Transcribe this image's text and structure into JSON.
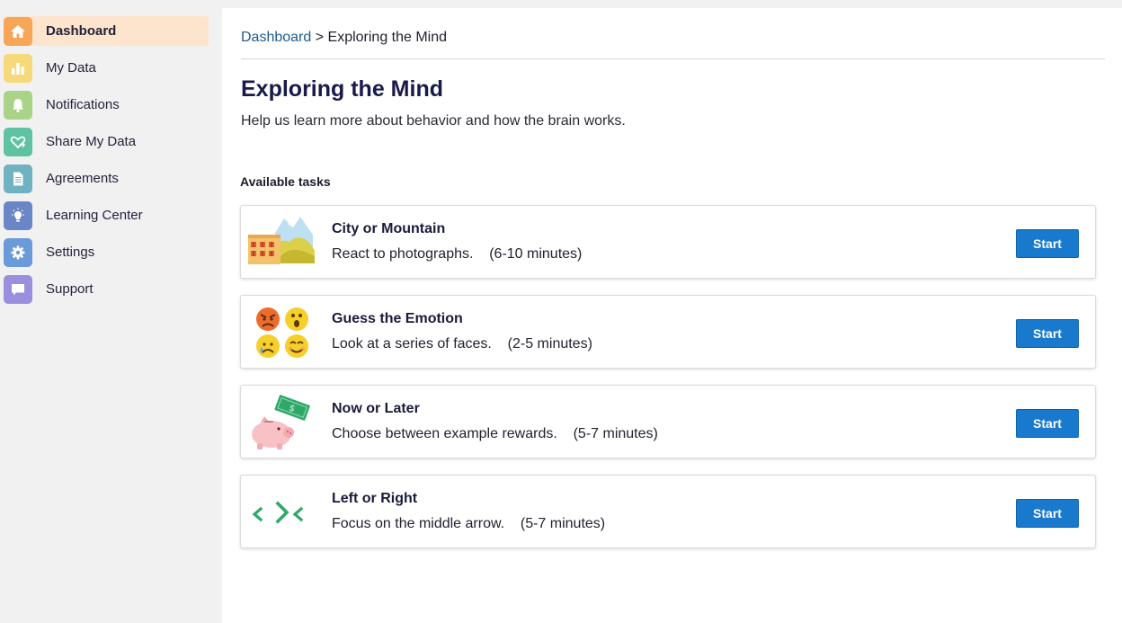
{
  "sidebar": {
    "items": [
      {
        "label": "Dashboard",
        "icon": "home-icon",
        "color": "#f7a556",
        "active": true
      },
      {
        "label": "My Data",
        "icon": "bar-chart-icon",
        "color": "#f5d97a"
      },
      {
        "label": "Notifications",
        "icon": "bell-icon",
        "color": "#a9d488"
      },
      {
        "label": "Share My Data",
        "icon": "heart-share-icon",
        "color": "#5fc2a0"
      },
      {
        "label": "Agreements",
        "icon": "document-icon",
        "color": "#6fb2c2"
      },
      {
        "label": "Learning Center",
        "icon": "lightbulb-icon",
        "color": "#6b86c6"
      },
      {
        "label": "Settings",
        "icon": "gear-icon",
        "color": "#6b9ad8"
      },
      {
        "label": "Support",
        "icon": "chat-bubble-icon",
        "color": "#9a8fdc"
      }
    ]
  },
  "breadcrumb": {
    "link": "Dashboard",
    "separator": " > ",
    "current": "Exploring the Mind"
  },
  "page": {
    "title": "Exploring the Mind",
    "subtitle": "Help us learn more about behavior and how the brain works.",
    "section_heading": "Available tasks"
  },
  "tasks": [
    {
      "title": "City or Mountain",
      "description": "React to photographs.    (6-10 minutes)",
      "button": "Start",
      "illustration": "city-mountain-illustration"
    },
    {
      "title": "Guess the Emotion",
      "description": "Look at a series of faces.    (2-5 minutes)",
      "button": "Start",
      "illustration": "emotion-faces-illustration"
    },
    {
      "title": "Now or Later",
      "description": "Choose between example rewards.    (5-7 minutes)",
      "button": "Start",
      "illustration": "piggy-bank-illustration"
    },
    {
      "title": "Left or Right",
      "description": "Focus on the middle arrow.    (5-7 minutes)",
      "button": "Start",
      "illustration": "arrows-illustration"
    }
  ],
  "colors": {
    "accent_button": "#1879cd",
    "active_nav_bg": "#fde4cc",
    "breadcrumb_link": "#1d5a8c",
    "title": "#181a4a"
  }
}
